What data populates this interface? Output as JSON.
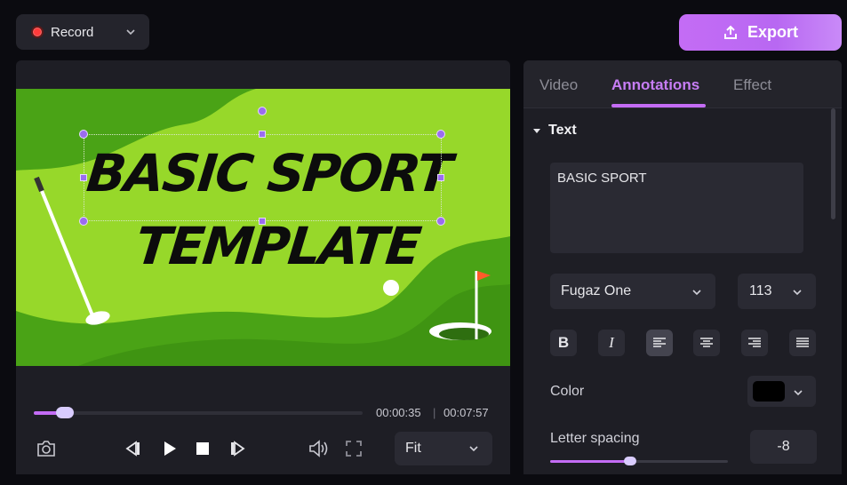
{
  "toolbar": {
    "record_label": "Record",
    "export_label": "Export"
  },
  "canvas": {
    "title_line1": "BASIC SPORT",
    "title_line2": "TEMPLATE",
    "background_color": "#97d82a",
    "dark_green": "#4aa316"
  },
  "player": {
    "current_time": "00:00:35",
    "total_time": "00:07:57",
    "progress_fraction": 0.094,
    "fit_label": "Fit"
  },
  "panel": {
    "tabs": [
      {
        "label": "Video"
      },
      {
        "label": "Annotations"
      },
      {
        "label": "Effect"
      }
    ],
    "active_tab": "Annotations",
    "section_title": "Text",
    "text_value": "BASIC SPORT",
    "font_name": "Fugaz One",
    "font_size": "113",
    "format_buttons": {
      "bold": "B",
      "italic": "I"
    },
    "color_label": "Color",
    "color_value": "#000000",
    "letter_spacing_label": "Letter spacing",
    "letter_spacing_value": "-8",
    "letter_spacing_fraction": 0.45
  },
  "colors": {
    "accent": "#c46cf5",
    "panel_bg": "#1e1e25",
    "app_bg": "#0b0b10"
  },
  "icons": {
    "record": "record-dot-icon",
    "export": "upload-icon",
    "snapshot": "camera-icon",
    "prev": "step-back-icon",
    "play": "play-icon",
    "stop": "stop-icon",
    "next": "step-forward-icon",
    "volume": "volume-icon",
    "fullscreen": "fullscreen-icon"
  }
}
